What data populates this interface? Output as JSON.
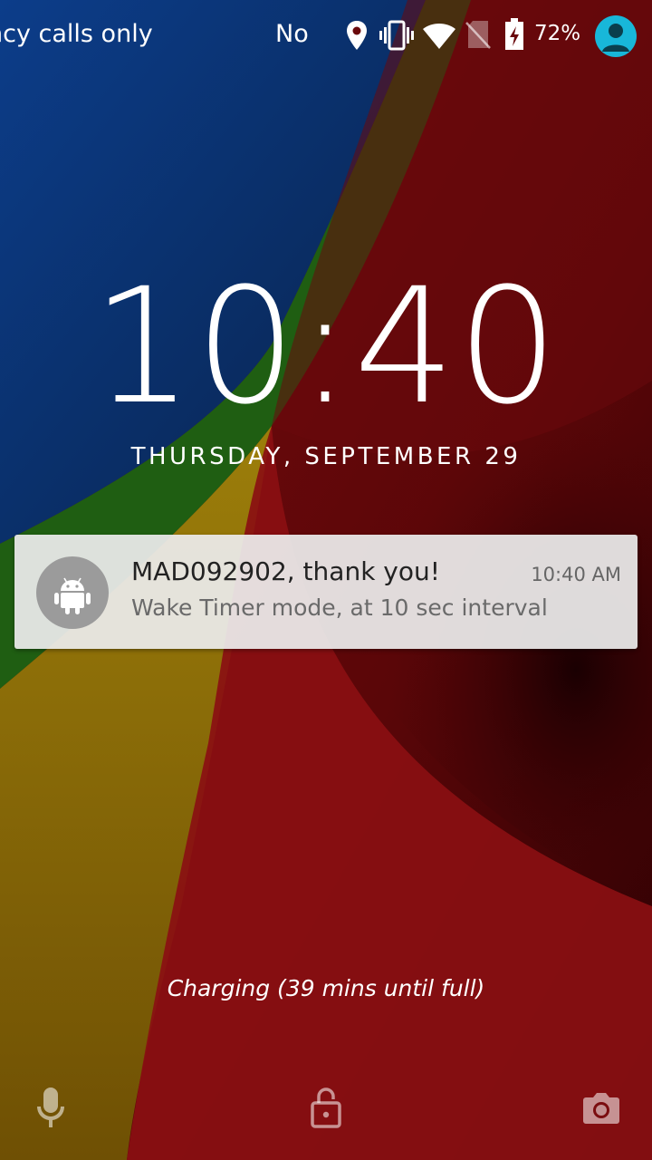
{
  "status_bar": {
    "carrier": "ncy calls only",
    "carrier_secondary": "No",
    "icons": [
      "location-icon",
      "vibrate-icon",
      "wifi-icon",
      "no-sim-icon",
      "battery-charging-icon"
    ],
    "battery_percent": "72%",
    "user_icon": "account-icon",
    "accent_color": "#18b7d9"
  },
  "lockscreen": {
    "time": "10:40",
    "date": "THURSDAY, SEPTEMBER 29",
    "charging_text": "Charging (39 mins until full)"
  },
  "notification": {
    "app_icon": "android-icon",
    "title": "MAD092902, thank you!",
    "time": "10:40 AM",
    "text": "Wake Timer mode, at 10 sec interval"
  },
  "bottom_actions": {
    "left": "microphone-icon",
    "center": "unlock-icon",
    "right": "camera-icon"
  }
}
